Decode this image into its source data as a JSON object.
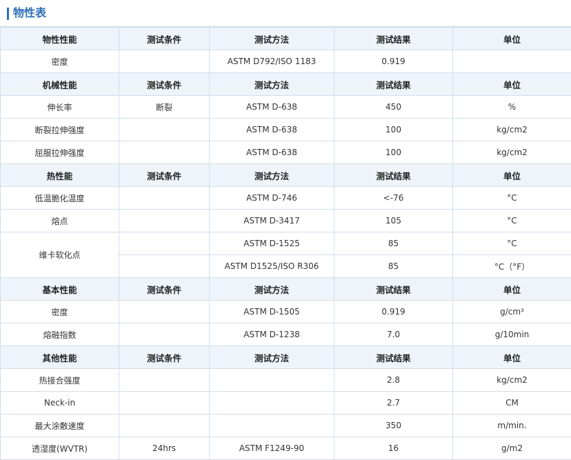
{
  "page": {
    "title": "物性表"
  },
  "colors": {
    "accent": "#2e6fb8",
    "header_bg": "#eef4fa",
    "border": "#cfdeea"
  },
  "table": {
    "sections": [
      {
        "header": [
          "物性性能",
          "测试条件",
          "测试方法",
          "测试结果",
          "单位"
        ],
        "rows": [
          [
            "密度",
            "",
            "ASTM D792/ISO 1183",
            "0.919",
            ""
          ]
        ]
      },
      {
        "header": [
          "机械性能",
          "测试条件",
          "测试方法",
          "测试结果",
          "单位"
        ],
        "rows": [
          [
            "伸长率",
            "断裂",
            "ASTM D-638",
            "450",
            "%"
          ],
          [
            "断裂拉伸强度",
            "",
            "ASTM D-638",
            "100",
            "kg/cm2"
          ],
          [
            "屈服拉伸强度",
            "",
            "ASTM D-638",
            "100",
            "kg/cm2"
          ]
        ]
      },
      {
        "header": [
          "热性能",
          "测试条件",
          "测试方法",
          "测试结果",
          "单位"
        ],
        "rows": [
          [
            "低温脆化温度",
            "",
            "ASTM D-746",
            "<-76",
            "°C"
          ],
          [
            "熔点",
            "",
            "ASTM D-3417",
            "105",
            "°C"
          ]
        ],
        "group": {
          "property": "维卡软化点",
          "rows": [
            [
              "",
              "ASTM D-1525",
              "85",
              "°C"
            ],
            [
              "",
              "ASTM D1525/ISO R306",
              "85",
              "°C（°F）"
            ]
          ]
        }
      },
      {
        "header": [
          "基本性能",
          "测试条件",
          "测试方法",
          "测试结果",
          "单位"
        ],
        "rows": [
          [
            "密度",
            "",
            "ASTM D-1505",
            "0.919",
            "g/cm³"
          ],
          [
            "熔融指数",
            "",
            "ASTM D-1238",
            "7.0",
            "g/10min"
          ]
        ]
      },
      {
        "header": [
          "其他性能",
          "测试条件",
          "测试方法",
          "测试结果",
          "单位"
        ],
        "rows": [
          [
            "热接合强度",
            "",
            "",
            "2.8",
            "kg/cm2"
          ],
          [
            "Neck-in",
            "",
            "",
            "2.7",
            "CM"
          ],
          [
            "最大涂敷速度",
            "",
            "",
            "350",
            "m/min."
          ],
          [
            "透湿度(WVTR)",
            "24hrs",
            "ASTM F1249-90",
            "16",
            "g/m2"
          ]
        ]
      }
    ]
  }
}
